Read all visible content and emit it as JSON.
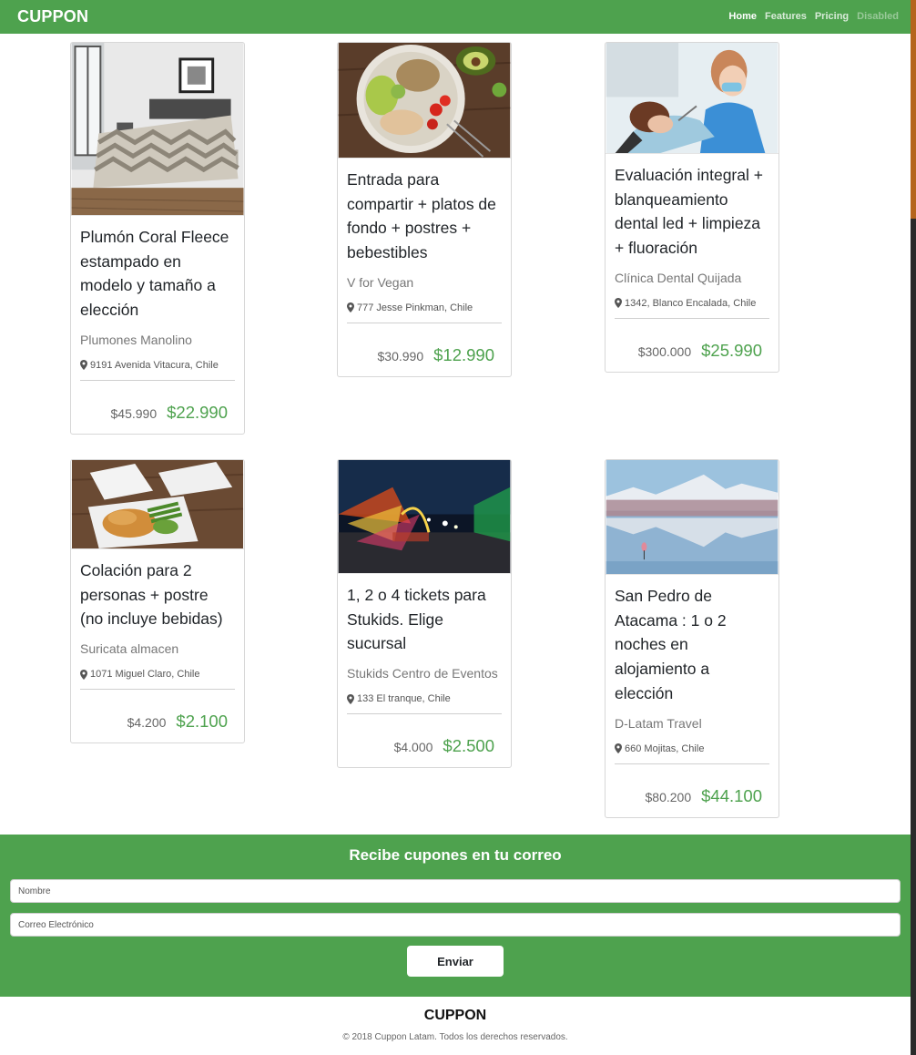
{
  "brand": "CUPPON",
  "nav": {
    "links": [
      {
        "label": "Home",
        "state": "active"
      },
      {
        "label": "Features",
        "state": "normal"
      },
      {
        "label": "Pricing",
        "state": "normal"
      },
      {
        "label": "Disabled",
        "state": "disabled"
      }
    ]
  },
  "colors": {
    "accent": "#4ea24e",
    "price_new": "#4ea24e"
  },
  "cards": [
    {
      "title": "Plumón Coral Fleece estampado en modelo y tamaño a elección",
      "vendor": "Plumones Manolino",
      "address": "9191 Avenida Vitacura, Chile",
      "old_price": "$45.990",
      "new_price": "$22.990",
      "image": "bedroom-comforter-photo"
    },
    {
      "title": "Entrada para compartir + platos de fondo + postres + bebestibles",
      "vendor": "V for Vegan",
      "address": "777 Jesse Pinkman, Chile",
      "old_price": "$30.990",
      "new_price": "$12.990",
      "image": "vegan-salad-bowl-photo"
    },
    {
      "title": "Evaluación integral + blanqueamiento dental led + limpieza + fluoración",
      "vendor": "Clínica Dental Quijada",
      "address": "1342, Blanco Encalada, Chile",
      "old_price": "$300.000",
      "new_price": "$25.990",
      "image": "dentist-patient-photo"
    },
    {
      "title": "Colación para 2 personas + postre (no incluye bebidas)",
      "vendor": "Suricata almacen",
      "address": "1071 Miguel Claro, Chile",
      "old_price": "$4.200",
      "new_price": "$2.100",
      "image": "takeaway-meal-photo"
    },
    {
      "title": "1, 2 o 4 tickets para Stukids. Elige sucursal",
      "vendor": "Stukids Centro de Eventos",
      "address": "133 El tranque, Chile",
      "old_price": "$4.000",
      "new_price": "$2.500",
      "image": "amusement-park-night-photo"
    },
    {
      "title": "San Pedro de Atacama : 1 o 2 noches en alojamiento a elección",
      "vendor": "D-Latam Travel",
      "address": "660 Mojitas, Chile",
      "old_price": "$80.200",
      "new_price": "$44.100",
      "image": "atacama-lagoon-photo"
    }
  ],
  "newsletter": {
    "title": "Recibe cupones en tu correo",
    "name_placeholder": "Nombre",
    "email_placeholder": "Correo Electrónico",
    "button_label": "Enviar"
  },
  "footer": {
    "brand": "CUPPON",
    "copyright": "© 2018 Cuppon Latam. Todos los derechos reservados."
  }
}
